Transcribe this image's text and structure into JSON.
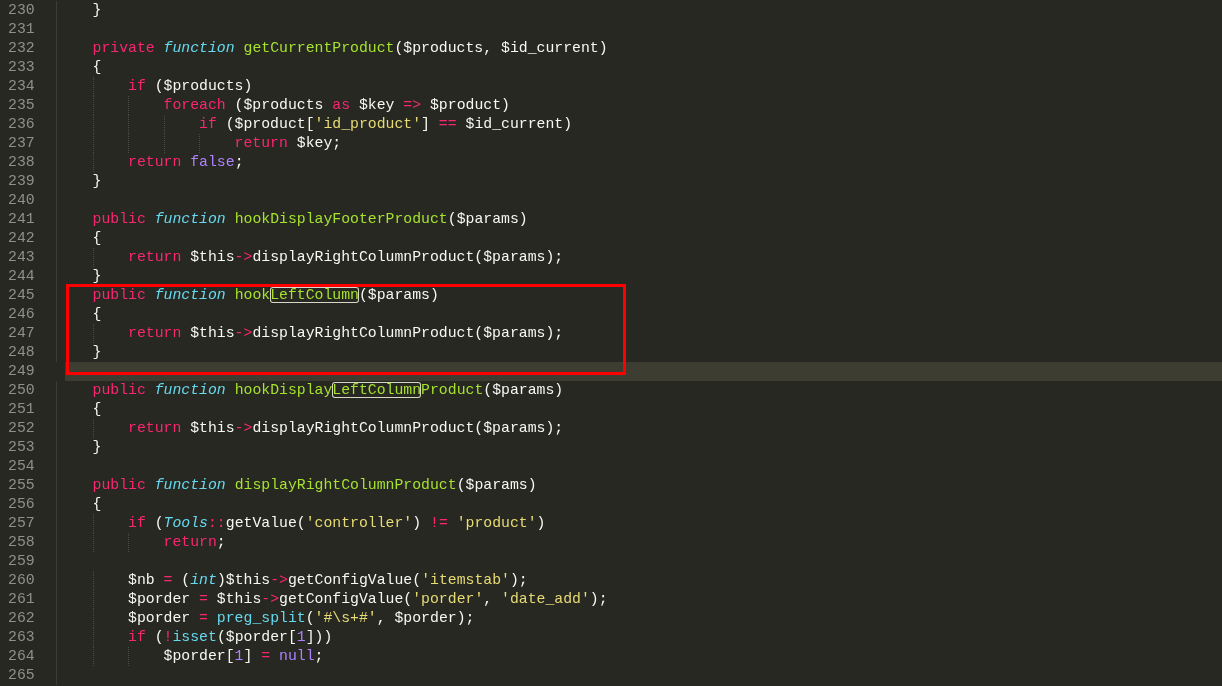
{
  "lines": [
    {
      "number": "230",
      "current": false,
      "boxed": false,
      "tokens": [
        {
          "kind": "plain",
          "text": "    }"
        }
      ]
    },
    {
      "number": "231",
      "current": false,
      "boxed": false
    },
    {
      "number": "232",
      "current": false,
      "boxed": false,
      "tokens": [
        {
          "kind": "keyword",
          "text": "    private "
        },
        {
          "kind": "storage",
          "text": "function "
        },
        {
          "kind": "entity",
          "text": "getCurrentProduct"
        },
        {
          "kind": "plain",
          "text": "($products, $id_current)"
        }
      ]
    },
    {
      "number": "233",
      "current": false,
      "boxed": false,
      "tokens": [
        {
          "kind": "plain",
          "text": "    {"
        }
      ]
    },
    {
      "number": "234",
      "current": false,
      "boxed": false,
      "tokens": [
        {
          "kind": "keyword",
          "text": "        if"
        },
        {
          "kind": "plain",
          "text": " ($products)"
        }
      ]
    },
    {
      "number": "235",
      "current": false,
      "boxed": false,
      "tokens": [
        {
          "kind": "keyword",
          "text": "            foreach"
        },
        {
          "kind": "plain",
          "text": " ($products "
        },
        {
          "kind": "keyword",
          "text": "as"
        },
        {
          "kind": "plain",
          "text": " $key "
        },
        {
          "kind": "keyword",
          "text": "=>"
        },
        {
          "kind": "plain",
          "text": " $product)"
        }
      ]
    },
    {
      "number": "236",
      "current": false,
      "boxed": false,
      "tokens": [
        {
          "kind": "keyword",
          "text": "                if"
        },
        {
          "kind": "plain",
          "text": " ($product["
        },
        {
          "kind": "string",
          "text": "'id_product'"
        },
        {
          "kind": "plain",
          "text": "] "
        },
        {
          "kind": "keyword",
          "text": "=="
        },
        {
          "kind": "plain",
          "text": " $id_current)"
        }
      ]
    },
    {
      "number": "237",
      "current": false,
      "boxed": false,
      "tokens": [
        {
          "kind": "keyword",
          "text": "                    return"
        },
        {
          "kind": "plain",
          "text": " $key;"
        }
      ]
    },
    {
      "number": "238",
      "current": false,
      "boxed": false,
      "tokens": [
        {
          "kind": "keyword",
          "text": "        return "
        },
        {
          "kind": "constant",
          "text": "false"
        },
        {
          "kind": "plain",
          "text": ";"
        }
      ]
    },
    {
      "number": "239",
      "current": false,
      "boxed": false,
      "tokens": [
        {
          "kind": "plain",
          "text": "    }"
        }
      ]
    },
    {
      "number": "240",
      "current": false,
      "boxed": false
    },
    {
      "number": "241",
      "current": false,
      "boxed": false,
      "tokens": [
        {
          "kind": "keyword",
          "text": "    public "
        },
        {
          "kind": "storage",
          "text": "function "
        },
        {
          "kind": "entity",
          "text": "hookDisplayFooterProduct"
        },
        {
          "kind": "plain",
          "text": "($params)"
        }
      ]
    },
    {
      "number": "242",
      "current": false,
      "boxed": false,
      "tokens": [
        {
          "kind": "plain",
          "text": "    {"
        }
      ]
    },
    {
      "number": "243",
      "current": false,
      "boxed": false,
      "tokens": [
        {
          "kind": "keyword",
          "text": "        return"
        },
        {
          "kind": "plain",
          "text": " $this"
        },
        {
          "kind": "keyword",
          "text": "->"
        },
        {
          "kind": "plain",
          "text": "displayRightColumnProduct($params);"
        }
      ]
    },
    {
      "number": "244",
      "current": false,
      "boxed": false,
      "tokens": [
        {
          "kind": "plain",
          "text": "    }"
        }
      ]
    },
    {
      "number": "245",
      "current": false,
      "boxed": true,
      "tokens": [
        {
          "kind": "keyword",
          "text": "    public "
        },
        {
          "kind": "storage",
          "text": "function "
        },
        {
          "kind": "entity",
          "text": "hook"
        },
        {
          "kind": "match",
          "text": "LeftColumn"
        },
        {
          "kind": "plain",
          "text": "($params)"
        }
      ]
    },
    {
      "number": "246",
      "current": false,
      "boxed": true,
      "tokens": [
        {
          "kind": "plain",
          "text": "    {"
        }
      ]
    },
    {
      "number": "247",
      "current": false,
      "boxed": true,
      "tokens": [
        {
          "kind": "keyword",
          "text": "        return"
        },
        {
          "kind": "plain",
          "text": " $this"
        },
        {
          "kind": "keyword",
          "text": "->"
        },
        {
          "kind": "plain",
          "text": "displayRightColumnProduct($params);"
        }
      ]
    },
    {
      "number": "248",
      "current": false,
      "boxed": true,
      "tokens": [
        {
          "kind": "plain",
          "text": "    }"
        }
      ]
    },
    {
      "number": "249",
      "current": true,
      "boxed": true
    },
    {
      "number": "250",
      "current": false,
      "boxed": false,
      "tokens": [
        {
          "kind": "keyword",
          "text": "    public "
        },
        {
          "kind": "storage",
          "text": "function "
        },
        {
          "kind": "entity",
          "text": "hookDisplay"
        },
        {
          "kind": "match",
          "text": "LeftColumn"
        },
        {
          "kind": "entity",
          "text": "Product"
        },
        {
          "kind": "plain",
          "text": "($params)"
        }
      ]
    },
    {
      "number": "251",
      "current": false,
      "boxed": false,
      "tokens": [
        {
          "kind": "plain",
          "text": "    {"
        }
      ]
    },
    {
      "number": "252",
      "current": false,
      "boxed": false,
      "tokens": [
        {
          "kind": "keyword",
          "text": "        return"
        },
        {
          "kind": "plain",
          "text": " $this"
        },
        {
          "kind": "keyword",
          "text": "->"
        },
        {
          "kind": "plain",
          "text": "displayRightColumnProduct($params);"
        }
      ]
    },
    {
      "number": "253",
      "current": false,
      "boxed": false,
      "tokens": [
        {
          "kind": "plain",
          "text": "    }"
        }
      ]
    },
    {
      "number": "254",
      "current": false,
      "boxed": false
    },
    {
      "number": "255",
      "current": false,
      "boxed": false,
      "tokens": [
        {
          "kind": "keyword",
          "text": "    public "
        },
        {
          "kind": "storage",
          "text": "function "
        },
        {
          "kind": "entity",
          "text": "displayRightColumnProduct"
        },
        {
          "kind": "plain",
          "text": "($params)"
        }
      ]
    },
    {
      "number": "256",
      "current": false,
      "boxed": false,
      "tokens": [
        {
          "kind": "plain",
          "text": "    {"
        }
      ]
    },
    {
      "number": "257",
      "current": false,
      "boxed": false,
      "tokens": [
        {
          "kind": "keyword",
          "text": "        if"
        },
        {
          "kind": "plain",
          "text": " ("
        },
        {
          "kind": "storage",
          "text": "Tools"
        },
        {
          "kind": "keyword",
          "text": "::"
        },
        {
          "kind": "plain",
          "text": "getValue("
        },
        {
          "kind": "string",
          "text": "'controller'"
        },
        {
          "kind": "plain",
          "text": ") "
        },
        {
          "kind": "keyword",
          "text": "!= "
        },
        {
          "kind": "string",
          "text": "'product'"
        },
        {
          "kind": "plain",
          "text": ")"
        }
      ]
    },
    {
      "number": "258",
      "current": false,
      "boxed": false,
      "tokens": [
        {
          "kind": "keyword",
          "text": "            return"
        },
        {
          "kind": "plain",
          "text": ";"
        }
      ]
    },
    {
      "number": "259",
      "current": false,
      "boxed": false
    },
    {
      "number": "260",
      "current": false,
      "boxed": false,
      "tokens": [
        {
          "kind": "plain",
          "text": "        $nb "
        },
        {
          "kind": "keyword",
          "text": "="
        },
        {
          "kind": "plain",
          "text": " ("
        },
        {
          "kind": "storage",
          "text": "int"
        },
        {
          "kind": "plain",
          "text": ")$this"
        },
        {
          "kind": "keyword",
          "text": "->"
        },
        {
          "kind": "plain",
          "text": "getConfigValue("
        },
        {
          "kind": "string",
          "text": "'itemstab'"
        },
        {
          "kind": "plain",
          "text": ");"
        }
      ]
    },
    {
      "number": "261",
      "current": false,
      "boxed": false,
      "tokens": [
        {
          "kind": "plain",
          "text": "        $porder "
        },
        {
          "kind": "keyword",
          "text": "="
        },
        {
          "kind": "plain",
          "text": " $this"
        },
        {
          "kind": "keyword",
          "text": "->"
        },
        {
          "kind": "plain",
          "text": "getConfigValue("
        },
        {
          "kind": "string",
          "text": "'porder'"
        },
        {
          "kind": "plain",
          "text": ", "
        },
        {
          "kind": "string",
          "text": "'date_add'"
        },
        {
          "kind": "plain",
          "text": ");"
        }
      ]
    },
    {
      "number": "262",
      "current": false,
      "boxed": false,
      "tokens": [
        {
          "kind": "plain",
          "text": "        $porder "
        },
        {
          "kind": "keyword",
          "text": "= "
        },
        {
          "kind": "support",
          "text": "preg_split"
        },
        {
          "kind": "plain",
          "text": "("
        },
        {
          "kind": "string",
          "text": "'#\\s+#'"
        },
        {
          "kind": "plain",
          "text": ", $porder);"
        }
      ]
    },
    {
      "number": "263",
      "current": false,
      "boxed": false,
      "tokens": [
        {
          "kind": "keyword",
          "text": "        if"
        },
        {
          "kind": "plain",
          "text": " ("
        },
        {
          "kind": "keyword",
          "text": "!"
        },
        {
          "kind": "support",
          "text": "isset"
        },
        {
          "kind": "plain",
          "text": "($porder["
        },
        {
          "kind": "constant",
          "text": "1"
        },
        {
          "kind": "plain",
          "text": "]))"
        }
      ]
    },
    {
      "number": "264",
      "current": false,
      "boxed": false,
      "tokens": [
        {
          "kind": "plain",
          "text": "            $porder["
        },
        {
          "kind": "constant",
          "text": "1"
        },
        {
          "kind": "plain",
          "text": "] "
        },
        {
          "kind": "keyword",
          "text": "= "
        },
        {
          "kind": "constant",
          "text": "null"
        },
        {
          "kind": "plain",
          "text": ";"
        }
      ]
    },
    {
      "number": "265",
      "current": false,
      "boxed": false
    }
  ]
}
